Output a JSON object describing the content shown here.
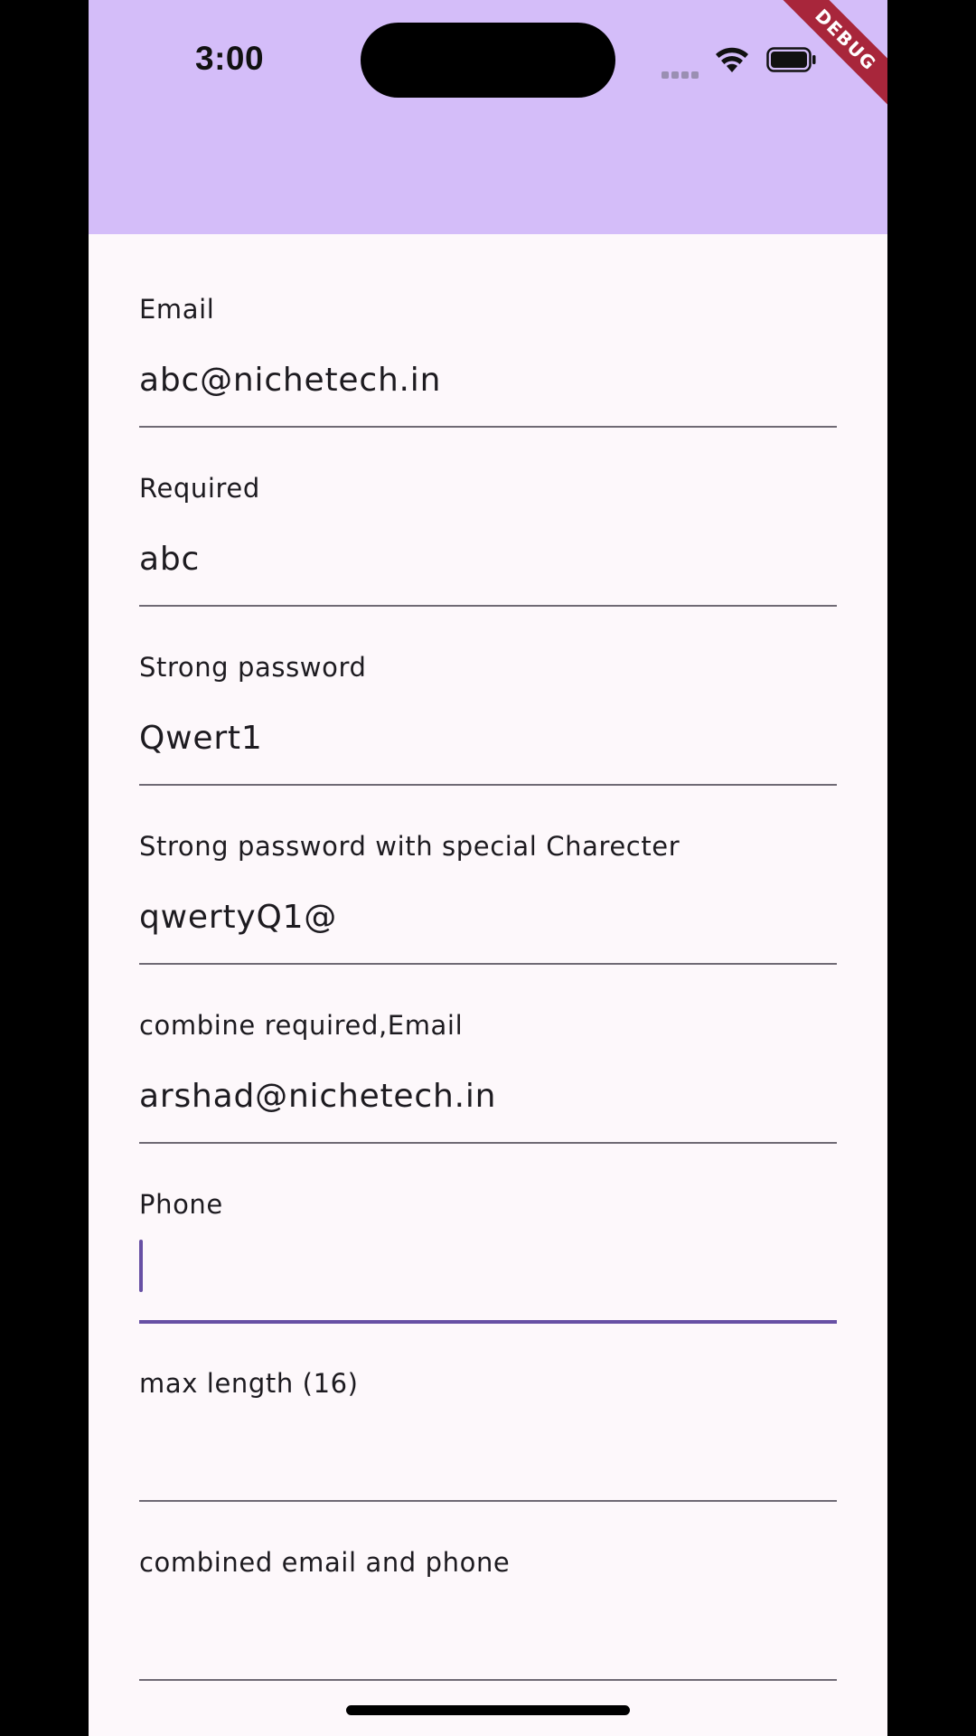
{
  "status_bar": {
    "time": "3:00",
    "icons": [
      "signal-dots-icon",
      "wifi-icon",
      "battery-icon"
    ]
  },
  "debug_banner": "DEBUG",
  "colors": {
    "app_bar": "#d4bdf9",
    "background": "#fdf8fb",
    "focus_accent": "#6750a4",
    "debug_banner": "#a8263b"
  },
  "fields": [
    {
      "label": "Email",
      "value": "abc@nichetech.in"
    },
    {
      "label": "Required",
      "value": "abc"
    },
    {
      "label": "Strong password",
      "value": "Qwert1"
    },
    {
      "label": "Strong password with special Charecter",
      "value": "qwertyQ1@"
    },
    {
      "label": "combine required,Email",
      "value": "arshad@nichetech.in"
    },
    {
      "label": "Phone",
      "value": "",
      "focused": true
    },
    {
      "label": "max length (16)",
      "value": ""
    },
    {
      "label": "combined email and phone",
      "value": ""
    }
  ]
}
